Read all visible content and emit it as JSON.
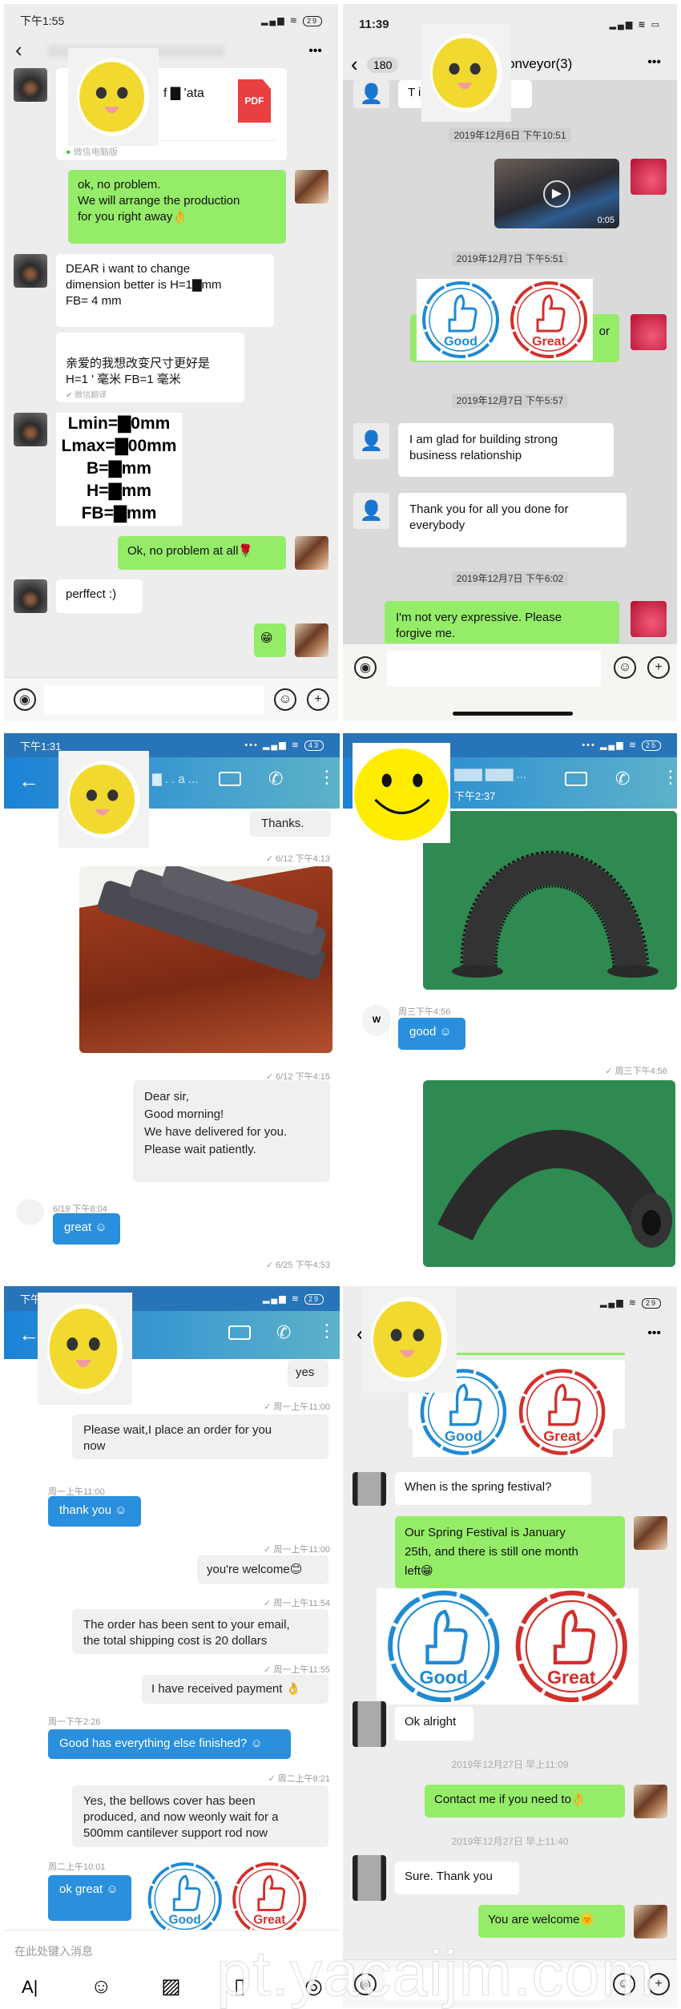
{
  "colors": {
    "wechat_green": "#95ec69",
    "qq_blue": "#2a8fdc",
    "stamp_blue": "#1f8ad2",
    "stamp_red": "#d2302c"
  },
  "stamps": {
    "good": "Good",
    "great": "Great"
  },
  "p1": {
    "status_time": "下午1:55",
    "battery": "29",
    "more": "•••",
    "pdf_name": "f ▇ 'ata",
    "pdf_label": "PDF",
    "pdf_source": "微信电脑版",
    "m1": "ok, no problem.\nWe will arrange the production\nfor you right away👌",
    "m2": "DEAR i want to change\ndimension  better is H=1▇mm\nFB=  4 mm",
    "m3": "亲爱的我想改变尺寸更好是\nH=1 ' 毫米 FB=1  毫米",
    "m3_footer": "微信翻译",
    "spec": [
      "Lmin=▇0mm",
      "Lmax=▇00mm",
      "B=▇mm",
      "H=▇mm",
      "FB=▇mm"
    ],
    "m4": "Ok, no problem at all🌹",
    "m5": "perffect :)",
    "m6": "😁"
  },
  "p2": {
    "status_time": "11:39",
    "back_count": "180",
    "title": "onveyor(3)",
    "more": "•••",
    "first_msg": "T                    in",
    "ts1": "2019年12月6日 下午10:51",
    "video_duration": "0:05",
    "ts2": "2019年12月7日 下午5:51",
    "m_partial": "or",
    "ts3": "2019年12月7日 下午5:57",
    "m1": "I am glad for building strong\nbusiness relationship",
    "m2": "Thank you for all you done for\neverybody",
    "ts4": "2019年12月7日 下午6:02",
    "m3": "I'm not very expressive. Please\nforgive me."
  },
  "p3": {
    "status_time": "下午1:31",
    "battery": "43",
    "title": "▇ . . a ...",
    "m1": "Thanks.",
    "ts1": "✓ 6/12 下午4:13",
    "ts2": "✓ 6/12 下午4:15",
    "m2": "Dear sir,\nGood morning!\nWe have delivered for you.\nPlease wait patiently.",
    "ts3": "6/19 下午8:04",
    "m3": "great ☺",
    "ts4": "✓ 6/25 下午4:53"
  },
  "p4": {
    "battery": "25",
    "title": "▇▇▇ ▇▇▇ ...",
    "subtitle": "下午2:37",
    "avatar_letter": "W",
    "ts1": "周三下午4:56",
    "m1": "good ☺",
    "ts2": "✓ 周三下午4:56"
  },
  "p5": {
    "status_time": "下午",
    "battery": "29",
    "m1": "yes",
    "ts1": "✓ 周一上午11:00",
    "m2": "Please wait,I place an order for you\nnow",
    "ts2": "周一上午11:00",
    "m3": "thank you ☺",
    "ts3": "✓ 周一上午11:00",
    "m4": "you're welcome😊",
    "ts4": "✓ 周一上午11:54",
    "m5": "The order has been sent to your email,\nthe total shipping cost is 20 dollars",
    "ts5": "✓ 周一上午11:55",
    "m6": "I have received payment 👌",
    "ts6": "周一下午2:26",
    "m7": "Good has everything else finished? ☺",
    "ts7": "✓ 周二上午8:21",
    "m8": "Yes, the bellows cover has been\nproduced, and now weonly wait for a\n500mm cantilever support rod now",
    "ts8": "周二上午10:01",
    "m9": "ok great ☺",
    "input_placeholder": "在此处键入消息",
    "toolbar": {
      "text": "A|",
      "emoji": "☺",
      "image": "▨",
      "file": "▯",
      "camera": "◎"
    }
  },
  "p6": {
    "battery": "29",
    "more": "•••",
    "m1": "When is the spring festival?",
    "m2": "Our Spring Festival is January\n25th, and there is still one month\nleft😁",
    "m3": "Ok alright",
    "ts1": "2019年12月27日 早上11:09",
    "m4": "Contact me if you need to👌",
    "ts2": "2019年12月27日 早上11:40",
    "m5": "Sure. Thank you",
    "m6": "You are welcome🌞"
  },
  "watermark": "pt.yacaijm.com"
}
